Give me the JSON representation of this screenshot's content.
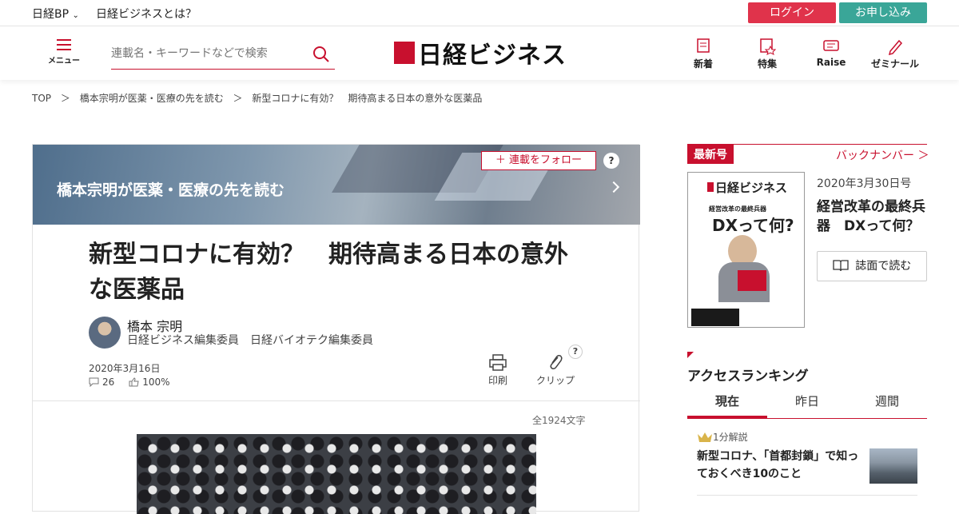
{
  "topbar": {
    "brand": "日経BP",
    "about": "日経ビジネスとは？",
    "login": "ログイン",
    "apply": "お申し込み"
  },
  "header": {
    "menu_label": "メニュー",
    "search_placeholder": "連載名・キーワードなどで検索",
    "logo_text": "日経ビジネス",
    "nav": [
      {
        "label": "新着",
        "icon": "new-icon"
      },
      {
        "label": "特集",
        "icon": "feature-icon"
      },
      {
        "label": "Raise",
        "icon": "raise-icon"
      },
      {
        "label": "ゼミナール",
        "icon": "pen-icon"
      }
    ]
  },
  "breadcrumb": [
    "TOP",
    "＞",
    "橋本宗明が医薬・医療の先を読む",
    "＞",
    "新型コロナに有効？　期待高まる日本の意外な医薬品"
  ],
  "article": {
    "series_title": "橋本宗明が医薬・医療の先を読む",
    "follow_label": "＋ 連載をフォロー",
    "help": "?",
    "title": "新型コロナに有効？　期待高まる日本の意外な医薬品",
    "author_name": "橋本 宗明",
    "author_role": "日経ビジネス編集委員　日経バイオテク編集委員",
    "date": "2020年3月16日",
    "comments": "26",
    "likes": "100%",
    "print_label": "印刷",
    "clip_label": "クリップ",
    "char_count": "全1924文字"
  },
  "sidebar": {
    "latest_label": "最新号",
    "backnumber": "バックナンバー ＞",
    "cover_logo": "日経ビジネス",
    "cover_sub": "経営改革の最終兵器",
    "cover_big": "DXって何?",
    "issue_date": "2020年3月30日号",
    "issue_title": "経営改革の最終兵器　DXって何？",
    "read_label": "誌面で読む",
    "ranking_title": "アクセスランキング",
    "tabs": [
      "現在",
      "昨日",
      "週間"
    ],
    "rank_badge": "1分解説",
    "rank_item": "新型コロナ、「首都封鎖」で知っておくべき10のこと"
  },
  "colors": {
    "brand_red": "#c8102e",
    "login": "#e0334b",
    "apply": "#3aa698"
  }
}
